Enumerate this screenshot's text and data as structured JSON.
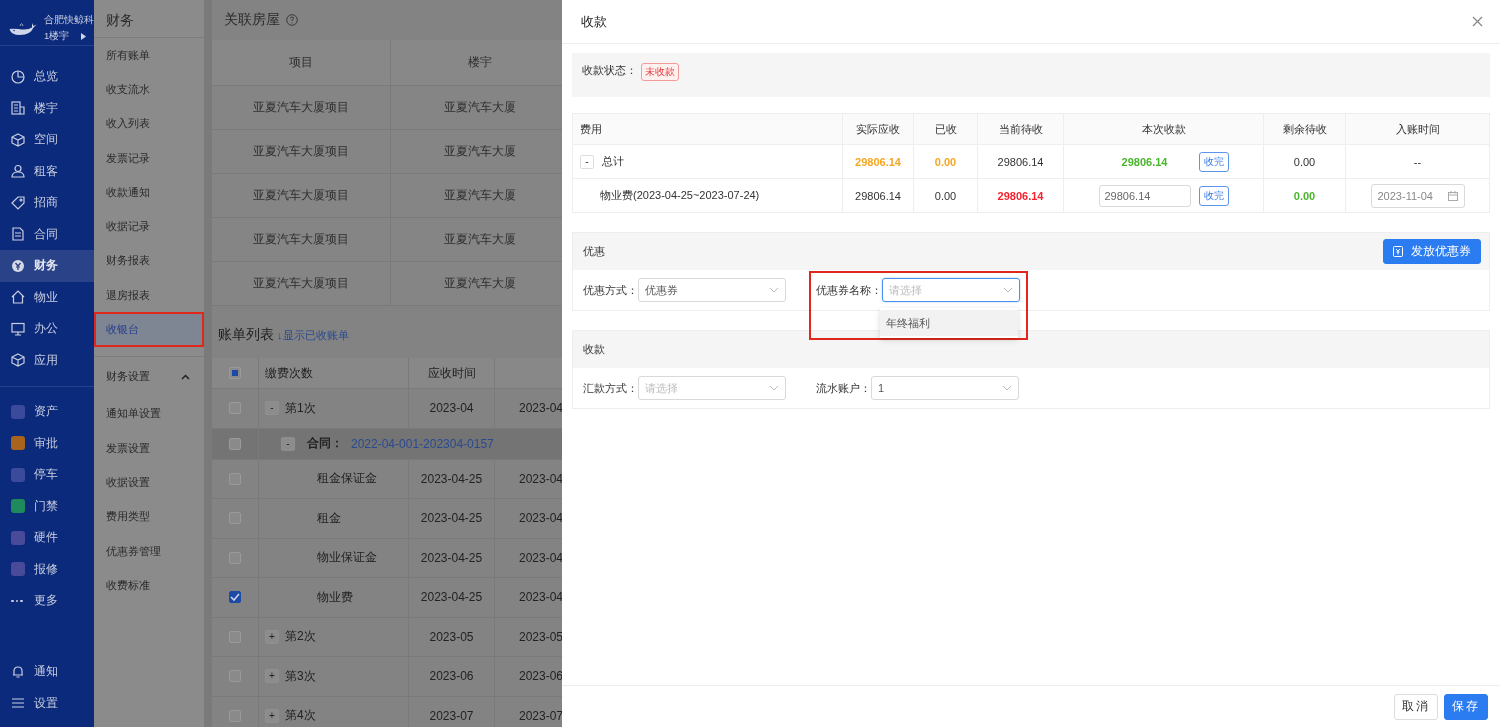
{
  "brand": {
    "name": "合肥快鲸科",
    "scope": "1楼宇"
  },
  "nav": [
    {
      "label": "总览",
      "selected": false
    },
    {
      "label": "楼宇",
      "selected": false
    },
    {
      "label": "空间",
      "selected": false
    },
    {
      "label": "租客",
      "selected": false
    },
    {
      "label": "招商",
      "selected": false
    },
    {
      "label": "合同",
      "selected": false
    },
    {
      "label": "财务",
      "selected": true
    },
    {
      "label": "物业",
      "selected": false
    },
    {
      "label": "办公",
      "selected": false
    },
    {
      "label": "应用",
      "selected": false
    }
  ],
  "apps": [
    {
      "label": "资产",
      "color": "#3b4a9a"
    },
    {
      "label": "审批",
      "color": "#a8631c"
    },
    {
      "label": "停车",
      "color": "#3b4a9a"
    },
    {
      "label": "门禁",
      "color": "#1f8a5c"
    },
    {
      "label": "硬件",
      "color": "#4a4a9a"
    },
    {
      "label": "报修",
      "color": "#4a4a9a"
    }
  ],
  "more": "更多",
  "bottom_nav": [
    {
      "label": "通知"
    },
    {
      "label": "设置"
    }
  ],
  "submenu": {
    "title": "财务",
    "items": [
      {
        "label": "所有账单",
        "selected": false
      },
      {
        "label": "收支流水",
        "selected": false
      },
      {
        "label": "收入列表",
        "selected": false
      },
      {
        "label": "发票记录",
        "selected": false
      },
      {
        "label": "收款通知",
        "selected": false
      },
      {
        "label": "收据记录",
        "selected": false
      },
      {
        "label": "财务报表",
        "selected": false
      },
      {
        "label": "退房报表",
        "selected": false
      },
      {
        "label": "收银台",
        "selected": true
      }
    ],
    "group": {
      "label": "财务设置",
      "expanded": true,
      "items": [
        {
          "label": "通知单设置"
        },
        {
          "label": "发票设置"
        },
        {
          "label": "收据设置"
        },
        {
          "label": "费用类型"
        },
        {
          "label": "优惠券管理"
        },
        {
          "label": "收费标准"
        }
      ]
    }
  },
  "houses": {
    "title": "关联房屋",
    "columns": [
      "项目",
      "楼宇"
    ],
    "rows": [
      [
        "亚夏汽车大厦项目",
        "亚夏汽车大厦"
      ],
      [
        "亚夏汽车大厦项目",
        "亚夏汽车大厦"
      ],
      [
        "亚夏汽车大厦项目",
        "亚夏汽车大厦"
      ],
      [
        "亚夏汽车大厦项目",
        "亚夏汽车大厦"
      ],
      [
        "亚夏汽车大厦项目",
        "亚夏汽车大厦"
      ]
    ]
  },
  "bills": {
    "title": "账单列表",
    "toggle_link": "↓显示已收账单",
    "all_indeterminate": true,
    "columns": [
      "缴费次数",
      "应收时间"
    ],
    "rows": [
      {
        "kind": "group",
        "toggle": "-",
        "label": "第1次",
        "date": "2023-04",
        "column_3": "2023-04",
        "checked": false
      },
      {
        "kind": "contract",
        "collapse": "-",
        "label": "合同：",
        "link": "2022-04-001-202304-0157",
        "checked": false
      },
      {
        "kind": "item",
        "label": "租金保证金",
        "date": "2023-04-25",
        "column_3": "2023-04",
        "checked": false
      },
      {
        "kind": "item",
        "label": "租金",
        "date": "2023-04-25",
        "column_3": "2023-04",
        "checked": false
      },
      {
        "kind": "item",
        "label": "物业保证金",
        "date": "2023-04-25",
        "column_3": "2023-04",
        "checked": false
      },
      {
        "kind": "item",
        "label": "物业费",
        "date": "2023-04-25",
        "column_3": "2023-04",
        "checked": true
      },
      {
        "kind": "group",
        "toggle": "+",
        "label": "第2次",
        "date": "2023-05",
        "column_3": "2023-05",
        "checked": false
      },
      {
        "kind": "group",
        "toggle": "+",
        "label": "第3次",
        "date": "2023-06",
        "column_3": "2023-06",
        "checked": false
      },
      {
        "kind": "group",
        "toggle": "+",
        "label": "第4次",
        "date": "2023-07",
        "column_3": "2023-07",
        "checked": false
      }
    ]
  },
  "drawer": {
    "title": "收款",
    "status": {
      "label": "收款状态：",
      "tag": "未收款"
    },
    "fees": {
      "columns": [
        "费用",
        "实际应收",
        "已收",
        "当前待收",
        "本次收款",
        "剩余待收",
        "入账时间"
      ],
      "total": {
        "toggle": "-",
        "label": "总计",
        "due": "29806.14",
        "received": "0.00",
        "pending": "29806.14",
        "this_payment": "29806.14",
        "button": "收完",
        "remaining": "0.00",
        "date": "--"
      },
      "rows": [
        {
          "label": "物业费(2023-04-25~2023-07-24)",
          "due": "29806.14",
          "received": "0.00",
          "pending": "29806.14",
          "this_payment": "29806.14",
          "button": "收完",
          "remaining": "0.00",
          "date": "2023-11-04"
        }
      ]
    },
    "discount": {
      "title": "优惠",
      "button": "发放优惠券",
      "method_label": "优惠方式：",
      "method_value": "优惠券",
      "coupon_label": "优惠券名称：",
      "coupon_placeholder": "请选择",
      "options": [
        "年终福利"
      ]
    },
    "payment": {
      "title": "收款",
      "method_label": "汇款方式：",
      "method_placeholder": "请选择",
      "account_label": "流水账户：",
      "account_value": "1"
    },
    "buttons": [
      {
        "kind": "secondary",
        "label": "取消"
      },
      {
        "kind": "primary",
        "label": "保存"
      }
    ]
  }
}
